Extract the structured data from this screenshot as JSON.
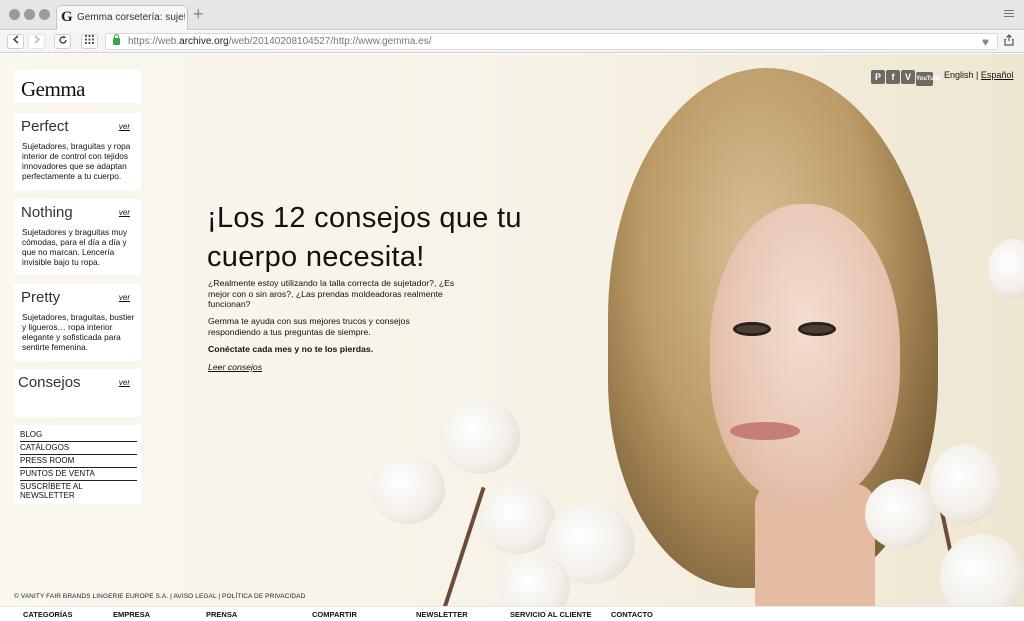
{
  "browser": {
    "tab_favicon": "G",
    "tab_title": "Gemma corsetería: sujetadore",
    "new_tab_symbol": "+",
    "url_prefix": "https://web.",
    "url_domain": "archive.org",
    "url_rest": "/web/20140208104527/http://www.gemma.es/"
  },
  "icons": {
    "back": "back-arrow-icon",
    "forward": "forward-arrow-icon",
    "reload": "reload-icon",
    "apps": "apps-grid-icon",
    "lock": "lock-icon",
    "bookmark": "heart-icon",
    "share": "share-icon"
  },
  "site": {
    "logo": "Gemma",
    "cards": [
      {
        "title": "Perfect",
        "link": "ver",
        "description": "Sujetadores, braguitas y ropa interior de control con tejidos innovadores que se adaptan perfectamente a tu cuerpo."
      },
      {
        "title": "Nothing",
        "link": "ver",
        "description": "Sujetadores y braguitas muy cómodas, para el día a día y que no marcan. Lencería invisible bajo tu ropa."
      },
      {
        "title": "Pretty",
        "link": "ver",
        "description": "Sujetadores, braguitas, bustier y ligueros… ropa interior elegante y sofisticada para sentirte femenina."
      },
      {
        "title": "Consejos",
        "link": "ver",
        "description": ""
      }
    ],
    "menu": [
      "BLOG",
      "CATÁLOGOS",
      "PRESS ROOM",
      "PUNTOS DE VENTA",
      "SUSCRÍBETE AL NEWSLETTER"
    ],
    "headline": "¡Los 12 consejos que tu cuerpo necesita!",
    "paragraph1": "¿Realmente estoy utilizando la talla correcta de sujetador?, ¿Es mejor con o sin aros?, ¿Las prendas moldeadoras realmente funcionan?",
    "paragraph2": "Gemma te ayuda con sus mejores trucos y consejos respondiendo a tus preguntas de siempre.",
    "paragraph3": "Conéctate cada mes y no te los pierdas.",
    "read_more": "Leer consejos",
    "social": [
      "P",
      "f",
      "V",
      "YouTube"
    ],
    "lang_en": "English",
    "lang_sep": "|",
    "lang_es": "Español",
    "legal": "© VANITY FAIR BRANDS LINGERIE EUROPE S.A. | AVISO LEGAL | POLÍTICA DE PRIVACIDAD",
    "footer": [
      "CATEGORÍAS",
      "EMPRESA",
      "PRENSA",
      "COMPARTIR",
      "NEWSLETTER",
      "SERVICIO AL CLIENTE",
      "CONTACTO"
    ]
  }
}
